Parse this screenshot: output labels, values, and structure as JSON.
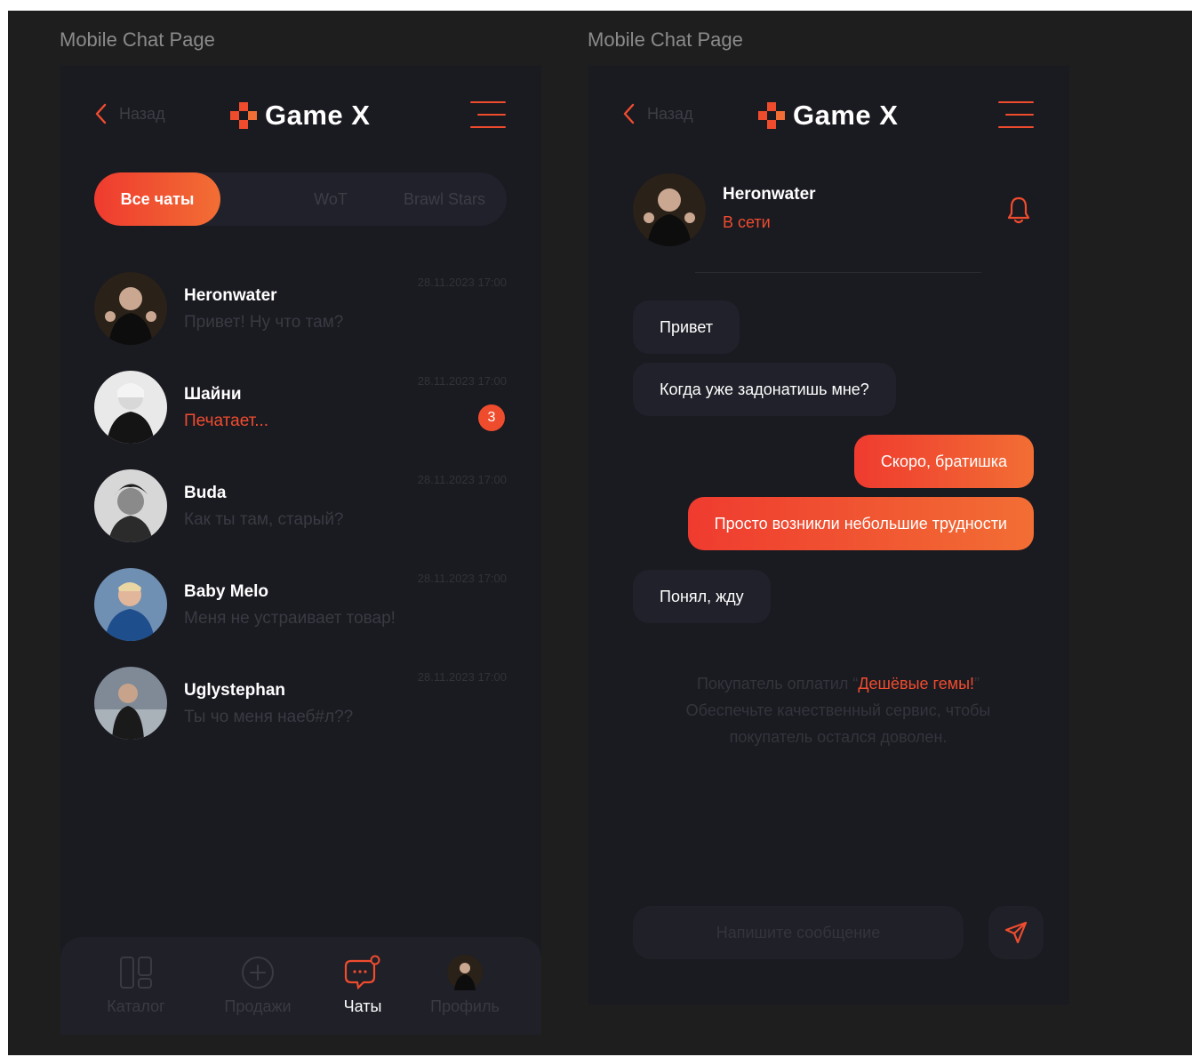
{
  "frames": [
    {
      "label": "Mobile Chat Page"
    },
    {
      "label": "Mobile Chat Page"
    }
  ],
  "header": {
    "back_label": "Назад",
    "app_title": "Game X"
  },
  "tabs": [
    {
      "label": "Все чаты",
      "active": true
    },
    {
      "label": "WoT",
      "active": false
    },
    {
      "label": "Brawl Stars",
      "active": false
    }
  ],
  "chats": [
    {
      "name": "Heronwater",
      "message": "Привет! Ну что там?",
      "time": "28.11.2023 17:00",
      "typing": false,
      "unread": null
    },
    {
      "name": "Шайни",
      "message": "Печатает...",
      "time": "28.11.2023 17:00",
      "typing": true,
      "unread": "3"
    },
    {
      "name": "Buda",
      "message": "Как ты там, старый?",
      "time": "28.11.2023 17:00",
      "typing": false,
      "unread": null
    },
    {
      "name": "Baby Melo",
      "message": "Меня не устраивает товар!",
      "time": "28.11.2023 17:00",
      "typing": false,
      "unread": null
    },
    {
      "name": "Uglystephan",
      "message": "Ты чо меня наеб#л??",
      "time": "28.11.2023 17:00",
      "typing": false,
      "unread": null
    }
  ],
  "bottom_nav": [
    {
      "label": "Каталог",
      "icon": "catalog-icon",
      "active": false
    },
    {
      "label": "Продажи",
      "icon": "plus-circle-icon",
      "active": false
    },
    {
      "label": "Чаты",
      "icon": "chat-icon",
      "active": true
    },
    {
      "label": "Профиль",
      "icon": "avatar",
      "active": false
    }
  ],
  "conversation": {
    "contact_name": "Heronwater",
    "contact_status": "В сети",
    "messages": [
      {
        "text": "Привет",
        "direction": "in"
      },
      {
        "text": "Когда уже задонатишь мне?",
        "direction": "in"
      },
      {
        "text": "Скоро, братишка",
        "direction": "out"
      },
      {
        "text": "Просто возникли небольшие трудности",
        "direction": "out"
      },
      {
        "text": "Понял, жду",
        "direction": "in"
      }
    ],
    "system_note": {
      "prefix": "Покупатель оплатил “",
      "highlight": "Дешёвые гемы!",
      "suffix": "” Обеспечьте качественный сервис, чтобы покупатель остался доволен."
    },
    "input_placeholder": "Напишите сообщение"
  },
  "colors": {
    "accent": "#ef4c2e",
    "accent_gradient_end": "#f26e34",
    "panel": "#1a1a21",
    "surface": "#20212a",
    "canvas": "#1e1e1e"
  }
}
